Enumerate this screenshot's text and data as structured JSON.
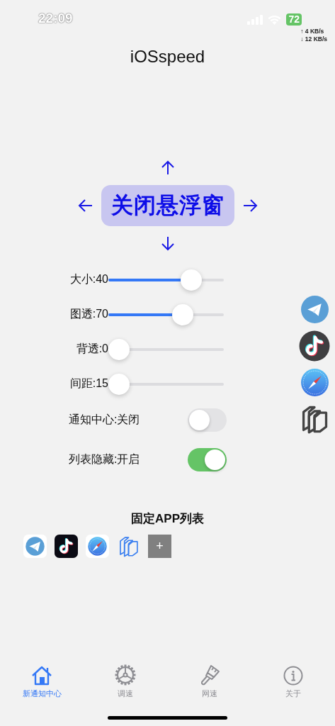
{
  "status_bar": {
    "time": "22:09",
    "battery": "72",
    "upload": "↑ 4 KB/s",
    "download": "↓ 12 KB/s"
  },
  "title": "iOSspeed",
  "float_button": {
    "label": "关闭悬浮窗"
  },
  "sliders": [
    {
      "label": "大小:40",
      "level": 0.77
    },
    {
      "label": "图透:70",
      "level": 0.68
    },
    {
      "label": "背透:0",
      "level": 0
    },
    {
      "label": "间距:15",
      "level": 0
    }
  ],
  "toggles": [
    {
      "label": "通知中心:关闭",
      "on": false
    },
    {
      "label": "列表隐藏:开启",
      "on": true
    }
  ],
  "pinned": {
    "title": "固定APP列表",
    "apps": [
      {
        "kind": "plane"
      },
      {
        "kind": "note"
      },
      {
        "kind": "compass"
      },
      {
        "kind": "stack"
      }
    ],
    "add_button": "+"
  },
  "side_apps": [
    {
      "kind": "plane"
    },
    {
      "kind": "note"
    },
    {
      "kind": "compass"
    },
    {
      "kind": "stack"
    }
  ],
  "tabs": [
    {
      "label": "新通知中心",
      "kind": "home",
      "selected": true
    },
    {
      "label": "调速",
      "kind": "gear",
      "selected": false
    },
    {
      "label": "网速",
      "kind": "brush",
      "selected": false
    },
    {
      "label": "关于",
      "kind": "info",
      "selected": false
    }
  ]
}
